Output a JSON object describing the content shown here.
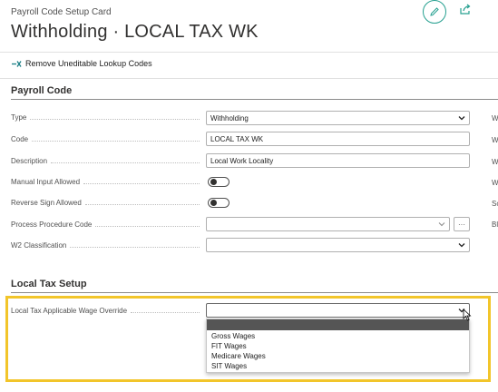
{
  "header": {
    "caption": "Payroll Code Setup Card",
    "title": "Withholding · LOCAL TAX WK"
  },
  "actions": {
    "remove_label": "Remove Uneditable Lookup Codes"
  },
  "payroll_code": {
    "heading": "Payroll Code",
    "type_label": "Type",
    "type_value": "Withholding",
    "code_label": "Code",
    "code_value": "LOCAL TAX WK",
    "description_label": "Description",
    "description_value": "Local Work Locality",
    "manual_input_label": "Manual Input Allowed",
    "reverse_sign_label": "Reverse Sign Allowed",
    "process_procedure_label": "Process Procedure Code",
    "process_procedure_value": "",
    "w2_label": "W2 Classification",
    "w2_value": "",
    "ellipsis": "···"
  },
  "right_column": [
    "W",
    "W",
    "W",
    "W",
    "Sc",
    "Bl"
  ],
  "local_tax": {
    "heading": "Local Tax Setup",
    "override_label": "Local Tax Applicable Wage Override",
    "override_value": "",
    "options": [
      "",
      "Gross Wages",
      "FIT Wages",
      "Medicare Wages",
      "SIT Wages"
    ]
  },
  "icons": {
    "edit": "pencil-icon",
    "share": "share-icon",
    "remove": "remove-lookup-icon",
    "chevron": "chevron-down-icon",
    "cursor": "mouse-cursor-icon"
  },
  "colors": {
    "accent": "#26a090",
    "highlight": "#f2c52a",
    "dropdown_selected": "#555555"
  }
}
